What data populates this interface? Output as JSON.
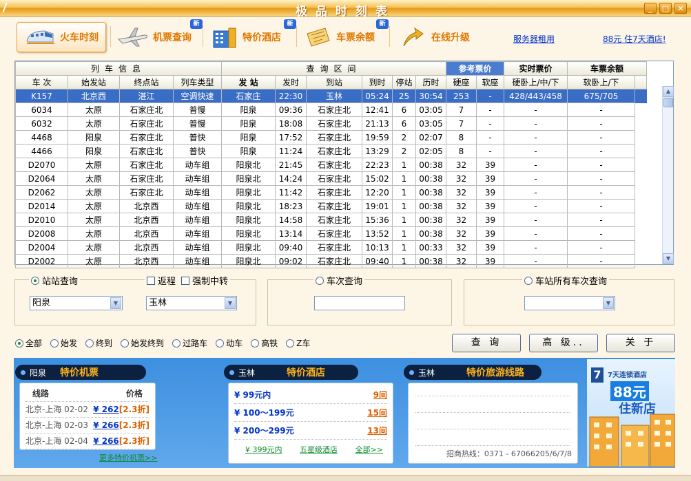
{
  "window": {
    "title": "极品时刻表"
  },
  "toolbar": {
    "tabs": [
      {
        "label": "火车时刻",
        "icon": "train-icon"
      },
      {
        "label": "机票查询",
        "icon": "airplane-icon",
        "badge": "新"
      },
      {
        "label": "特价酒店",
        "icon": "hotel-icon",
        "badge": "新"
      },
      {
        "label": "车票余额",
        "icon": "ticket-icon",
        "badge": "新"
      },
      {
        "label": "在线升级",
        "icon": "upgrade-arrow-icon"
      }
    ],
    "link_server": "服务器租用",
    "link_hotel": "88元 住7天酒店!"
  },
  "grid": {
    "group_headers": {
      "train_info": "列车信息",
      "query_range": "查询区间",
      "ref_price": "参考票价",
      "live_price": "实时票价",
      "remaining": "车票余额"
    },
    "columns": [
      "车 次",
      "始发站",
      "终点站",
      "列车类型",
      "发 站",
      "发时",
      "到站",
      "到时",
      "停站",
      "历时",
      "硬座",
      "软座",
      "硬卧上/中/下",
      "软卧上/下"
    ],
    "rows": [
      [
        "K157",
        "北京西",
        "湛江",
        "空调快速",
        "石家庄",
        "22:30",
        "玉林",
        "05:24",
        "25",
        "30:54",
        "253",
        "-",
        "428/443/458",
        "675/705"
      ],
      [
        "6034",
        "太原",
        "石家庄北",
        "普慢",
        "阳泉",
        "09:36",
        "石家庄北",
        "12:41",
        "6",
        "03:05",
        "7",
        "-",
        "-",
        "-"
      ],
      [
        "6032",
        "太原",
        "石家庄北",
        "普慢",
        "阳泉",
        "18:08",
        "石家庄北",
        "21:13",
        "6",
        "03:05",
        "7",
        "-",
        "-",
        "-"
      ],
      [
        "4468",
        "阳泉",
        "石家庄北",
        "普快",
        "阳泉",
        "17:52",
        "石家庄北",
        "19:59",
        "2",
        "02:07",
        "8",
        "-",
        "-",
        "-"
      ],
      [
        "4466",
        "阳泉",
        "石家庄北",
        "普快",
        "阳泉",
        "11:24",
        "石家庄北",
        "13:29",
        "2",
        "02:05",
        "8",
        "-",
        "-",
        "-"
      ],
      [
        "D2070",
        "太原",
        "石家庄北",
        "动车组",
        "阳泉北",
        "21:45",
        "石家庄北",
        "22:23",
        "1",
        "00:38",
        "32",
        "39",
        "-",
        "-"
      ],
      [
        "D2064",
        "太原",
        "石家庄北",
        "动车组",
        "阳泉北",
        "14:24",
        "石家庄北",
        "15:02",
        "1",
        "00:38",
        "32",
        "39",
        "-",
        "-"
      ],
      [
        "D2062",
        "太原",
        "石家庄北",
        "动车组",
        "阳泉北",
        "11:42",
        "石家庄北",
        "12:20",
        "1",
        "00:38",
        "32",
        "39",
        "-",
        "-"
      ],
      [
        "D2014",
        "太原",
        "北京西",
        "动车组",
        "阳泉北",
        "18:23",
        "石家庄北",
        "19:01",
        "1",
        "00:38",
        "32",
        "39",
        "-",
        "-"
      ],
      [
        "D2010",
        "太原",
        "北京西",
        "动车组",
        "阳泉北",
        "14:58",
        "石家庄北",
        "15:36",
        "1",
        "00:38",
        "32",
        "39",
        "-",
        "-"
      ],
      [
        "D2008",
        "太原",
        "北京西",
        "动车组",
        "阳泉北",
        "13:14",
        "石家庄北",
        "13:52",
        "1",
        "00:38",
        "32",
        "39",
        "-",
        "-"
      ],
      [
        "D2004",
        "太原",
        "北京西",
        "动车组",
        "阳泉北",
        "09:40",
        "石家庄北",
        "10:13",
        "1",
        "00:33",
        "32",
        "39",
        "-",
        "-"
      ],
      [
        "D2002",
        "太原",
        "北京西",
        "动车组",
        "阳泉北",
        "09:02",
        "石家庄北",
        "09:40",
        "1",
        "00:38",
        "32",
        "39",
        "-",
        "-"
      ]
    ]
  },
  "query": {
    "station": {
      "label": "站站查询",
      "return_label": "返程",
      "force_transfer_label": "强制中转",
      "from": "阳泉",
      "to": "玉林"
    },
    "train": {
      "label": "车次查询",
      "value": ""
    },
    "all_trains": {
      "label": "车站所有车次查询",
      "value": ""
    },
    "filters": [
      "全部",
      "始发",
      "终到",
      "始发终到",
      "过路车",
      "动车",
      "高铁",
      "Z车"
    ],
    "buttons": {
      "query": "查 询",
      "advanced": "高 级..",
      "close": "关 于"
    }
  },
  "ads": {
    "flights": {
      "city": "阳泉",
      "title": "特价机票",
      "col_route": "线路",
      "col_price": "价格",
      "rows": [
        {
          "route": "北京-上海 02-02",
          "price": "¥ 262",
          "disc": "[2.3折]"
        },
        {
          "route": "北京-上海 02-03",
          "price": "¥ 266",
          "disc": "[2.3折]"
        },
        {
          "route": "北京-上海 02-04",
          "price": "¥ 266",
          "disc": "[2.3折]"
        }
      ],
      "more": "更多特价机票>>"
    },
    "hotels": {
      "city": "玉林",
      "title": "特价酒店",
      "rows": [
        {
          "range": "¥ 99元内",
          "count": "9间"
        },
        {
          "range": "¥ 100～199元",
          "count": "15间"
        },
        {
          "range": "¥ 200～299元",
          "count": "13间"
        }
      ],
      "link1": "¥ 399元内",
      "link2": "五星级酒店",
      "link3": "全部>>"
    },
    "tours": {
      "city": "玉林",
      "title": "特价旅游线路",
      "hotline": "招商热线：0371 - 67066205/6/7/8"
    },
    "banner": {
      "logo_text": "7",
      "brand": "7天连锁酒店",
      "price": "88元",
      "slogan": "住新店"
    }
  }
}
